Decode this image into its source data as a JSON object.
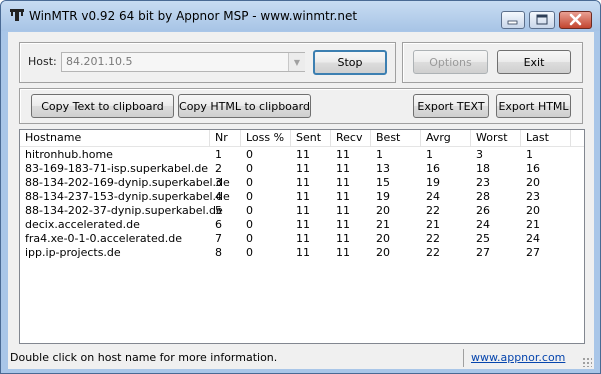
{
  "window": {
    "title": "WinMTR v0.92 64 bit by Appnor MSP - www.winmtr.net"
  },
  "host_group": {
    "host_label": "Host:",
    "host_value": "84.201.10.5",
    "stop_label": "Stop"
  },
  "right_group": {
    "options_label": "Options",
    "exit_label": "Exit"
  },
  "toolbar": {
    "copy_text_label": "Copy Text to clipboard",
    "copy_html_label": "Copy HTML to clipboard",
    "export_text_label": "Export TEXT",
    "export_html_label": "Export HTML"
  },
  "table": {
    "columns": [
      "Hostname",
      "Nr",
      "Loss %",
      "Sent",
      "Recv",
      "Best",
      "Avrg",
      "Worst",
      "Last"
    ],
    "rows": [
      [
        "hitronhub.home",
        "1",
        "0",
        "11",
        "11",
        "1",
        "1",
        "3",
        "1"
      ],
      [
        "83-169-183-71-isp.superkabel.de",
        "2",
        "0",
        "11",
        "11",
        "13",
        "16",
        "18",
        "16"
      ],
      [
        "88-134-202-169-dynip.superkabel.de",
        "3",
        "0",
        "11",
        "11",
        "15",
        "19",
        "23",
        "20"
      ],
      [
        "88-134-237-153-dynip.superkabel.de",
        "4",
        "0",
        "11",
        "11",
        "19",
        "24",
        "28",
        "23"
      ],
      [
        "88-134-202-37-dynip.superkabel.de",
        "5",
        "0",
        "11",
        "11",
        "20",
        "22",
        "26",
        "20"
      ],
      [
        "decix.accelerated.de",
        "6",
        "0",
        "11",
        "11",
        "21",
        "21",
        "24",
        "21"
      ],
      [
        "fra4.xe-0-1-0.accelerated.de",
        "7",
        "0",
        "11",
        "11",
        "20",
        "22",
        "25",
        "24"
      ],
      [
        "ipp.ip-projects.de",
        "8",
        "0",
        "11",
        "11",
        "20",
        "22",
        "27",
        "27"
      ]
    ]
  },
  "status": {
    "message": "Double click on host name for more information.",
    "link": "www.appnor.com"
  }
}
